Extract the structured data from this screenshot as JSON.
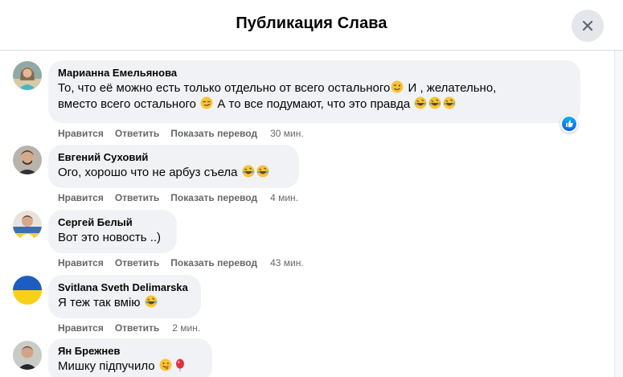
{
  "header": {
    "title": "Публикация Слава",
    "close_icon": "close-icon"
  },
  "actions": {
    "like": "Нравится",
    "reply": "Ответить",
    "translate": "Показать перевод"
  },
  "comments": [
    {
      "author": "Марианна Емельянова",
      "line1": "То, что её можно есть только отдельно от всего остального",
      "line1b": " И , желательно,",
      "line2": "вместо всего остального ",
      "line2b": " А то все подумают, что это правда ",
      "time": "30 мин.",
      "reaction": "like-icon"
    },
    {
      "author": "Евгений Суховий",
      "line1": "Ого, хорошо что не арбуз съела ",
      "time": "4 мин."
    },
    {
      "author": "Сергей Белый",
      "line1": "Вот это новость ..)",
      "time": "43 мин."
    },
    {
      "author": "Svitlana Sveth Delimarska",
      "line1": "Я теж так вмію ",
      "time": "2 мин."
    },
    {
      "author": "Ян Брежнев",
      "line1": "Мишку підпучило "
    }
  ],
  "colors": {
    "bubble": "#f0f2f5",
    "secondary_text": "#65676b",
    "like_blue": "#1877f2"
  }
}
